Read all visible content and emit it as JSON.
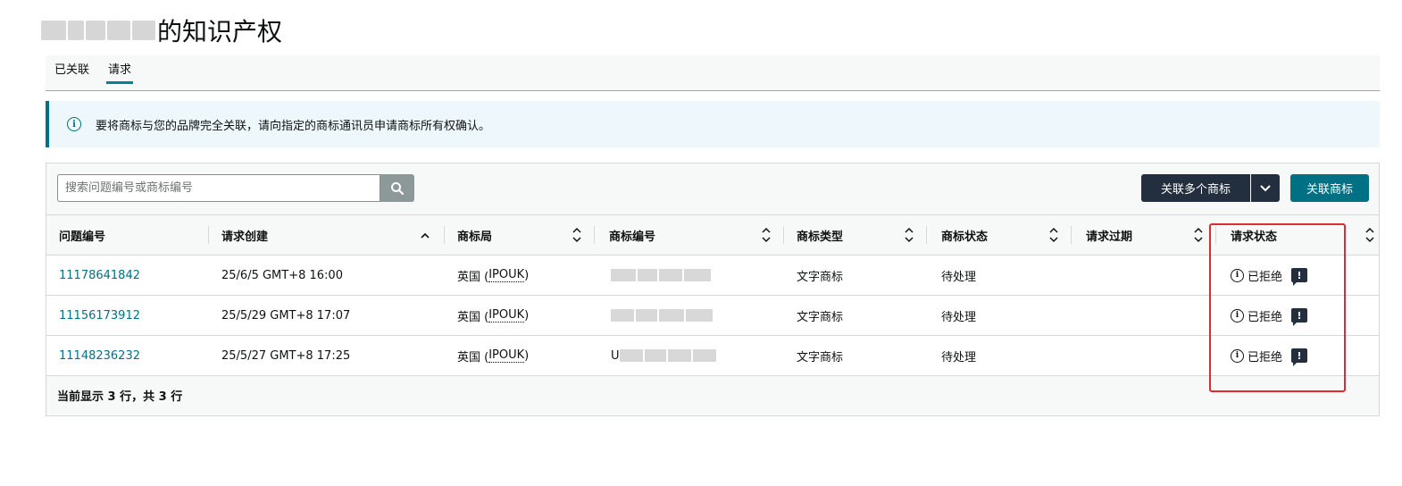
{
  "page": {
    "title": "的知识产权"
  },
  "tabs": [
    {
      "label": "已关联",
      "active": false
    },
    {
      "label": "请求",
      "active": true
    }
  ],
  "alert": {
    "icon": "info-icon",
    "text": "要将商标与您的品牌完全关联，请向指定的商标通讯员申请商标所有权确认。"
  },
  "toolbar": {
    "search_placeholder": "搜索问题编号或商标编号",
    "search_icon": "search-icon",
    "link_multiple_label": "关联多个商标",
    "link_label": "关联商标"
  },
  "table": {
    "columns": [
      "问题编号",
      "请求创建",
      "商标局",
      "商标编号",
      "商标类型",
      "商标状态",
      "请求过期",
      "请求状态"
    ],
    "rows": [
      {
        "issue_id": "11178641842",
        "created": "25/6/5 GMT+8 16:00",
        "office_name": "英国 (",
        "office_abbr": "IPOUK",
        "office_tail": ")",
        "tm_prefix": "",
        "tm_type": "文字商标",
        "tm_status": "待处理",
        "expiry": "",
        "status": "已拒绝"
      },
      {
        "issue_id": "11156173912",
        "created": "25/5/29 GMT+8 17:07",
        "office_name": "英国 (",
        "office_abbr": "IPOUK",
        "office_tail": ")",
        "tm_prefix": "",
        "tm_type": "文字商标",
        "tm_status": "待处理",
        "expiry": "",
        "status": "已拒绝"
      },
      {
        "issue_id": "11148236232",
        "created": "25/5/27 GMT+8 17:25",
        "office_name": "英国 (",
        "office_abbr": "IPOUK",
        "office_tail": ")",
        "tm_prefix": "U",
        "tm_type": "文字商标",
        "tm_status": "待处理",
        "expiry": "",
        "status": "已拒绝"
      }
    ],
    "footer": "当前显示 3 行，共 3 行"
  },
  "colors": {
    "accent": "#007185",
    "dark_button": "#232f3e",
    "highlight": "#e3292f",
    "alert_bg": "#eef8fc"
  }
}
